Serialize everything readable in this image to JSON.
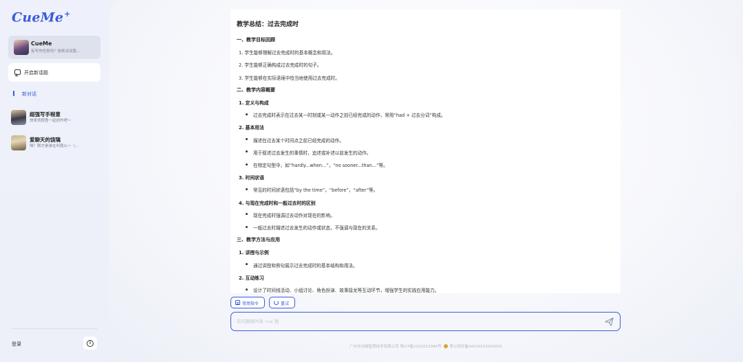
{
  "sidebar": {
    "logo": "CueMe",
    "logo_mark": "+",
    "agent": {
      "name": "CueMe",
      "subtitle": "有写作任务吗？快来试试我..."
    },
    "new_topic_label": "开启新话题",
    "active_conversation": "新对话",
    "conversations": [
      {
        "name": "超强写手程意",
        "subtitle": "快来找程意一起创作吧～"
      },
      {
        "name": "爱聊天的饶璃",
        "subtitle": "嘿？刚才是谁在叫我么～（..."
      }
    ],
    "login_label": "登录",
    "info_icon": "info-icon"
  },
  "document": {
    "title": "教学总结：过去完成时",
    "lines": [
      {
        "kind": "h2",
        "text": "一、教学目标回顾"
      },
      {
        "kind": "p",
        "text": "1. 学生能够理解过去完成时的基本概念和用法。"
      },
      {
        "kind": "p",
        "text": "2. 学生能够正确构成过去完成时的句子。"
      },
      {
        "kind": "p",
        "text": "3. 学生能够在实际语境中恰当地使用过去完成时。"
      },
      {
        "kind": "h2",
        "text": "二、教学内容概要"
      },
      {
        "kind": "h3",
        "text": "1. 定义与构成"
      },
      {
        "kind": "bullet",
        "text": "过去完成时表示在过去某一时刻或某一动作之前已经完成的动作，常用“had + 过去分词”构成。"
      },
      {
        "kind": "h3",
        "text": "2. 基本用法"
      },
      {
        "kind": "bullet",
        "text": "描述在过去某个时间点之前已经完成的动作。"
      },
      {
        "kind": "bullet",
        "text": "用于叙述过去发生的事情时，追述或补述以前发生的动作。"
      },
      {
        "kind": "bullet",
        "text": "在特定句型中，如“hardly...when...”，“no sooner...than...”等。"
      },
      {
        "kind": "h3",
        "text": "3. 时间状语"
      },
      {
        "kind": "bullet",
        "text": "常见的时间状语包括“by the time”，“before”，“after”等。"
      },
      {
        "kind": "h3",
        "text": "4. 与现在完成时和一般过去时的区别"
      },
      {
        "kind": "bullet",
        "text": "现在完成时强调过去动作对现在的影响。"
      },
      {
        "kind": "bullet",
        "text": "一般过去时描述过去发生的动作或状态，不强调与现在的关系。"
      },
      {
        "kind": "h2",
        "text": "三、教学方法与应用"
      },
      {
        "kind": "h3",
        "text": "1. 讲授与示例"
      },
      {
        "kind": "bullet",
        "text": "通过讲授和例句展示过去完成时的基本结构和用法。"
      },
      {
        "kind": "h3",
        "text": "2. 互动练习"
      },
      {
        "kind": "bullet",
        "text": "设计了时间线活动、小组讨论、角色扮演、故事接龙等互动环节，增强学生的实践应用能力。"
      }
    ]
  },
  "toolbar": {
    "commands_label": "常用指令",
    "retry_label": "重试"
  },
  "input": {
    "placeholder": "有问题随时来 cue 我",
    "value": ""
  },
  "footer": {
    "company": "广州市动微智慧技术有限公司 粤ICP备2022013984号",
    "police": "粤公网安备44010502003055"
  },
  "colors": {
    "accent": "#3a5bd9",
    "sidebar_bg": "#eef1fb",
    "card_bg": "#dde2ec"
  }
}
